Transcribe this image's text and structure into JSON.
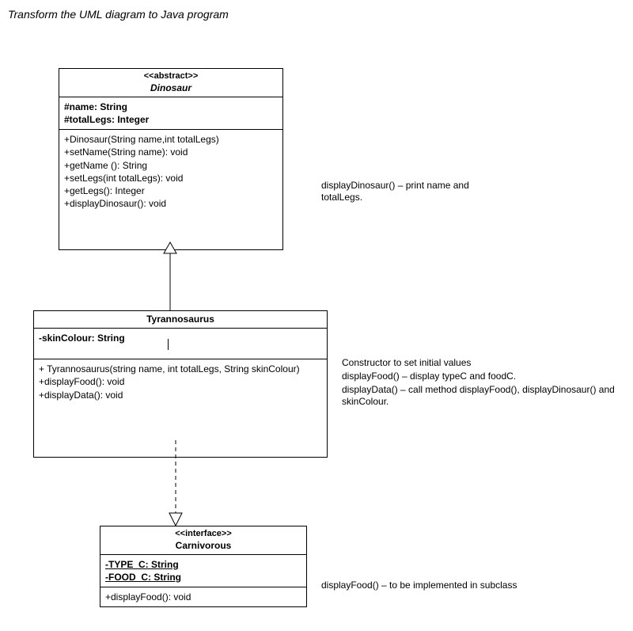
{
  "title": "Transform the UML diagram to Java program",
  "dinosaur": {
    "stereotype": "<<abstract>>",
    "name": "Dinosaur",
    "attrs": {
      "a1": "#name: String",
      "a2": "#totalLegs: Integer"
    },
    "ops": {
      "o1": "+Dinosaur(String name,int totalLegs)",
      "o2": "+setName(String name): void",
      "o3": "+getName (): String",
      "o4": "+setLegs(int totalLegs): void",
      "o5": "+getLegs(): Integer",
      "o6": "+displayDinosaur(): void"
    }
  },
  "tyranno": {
    "name": "Tyrannosaurus",
    "attrs": {
      "a1": "-skinColour: String"
    },
    "ops": {
      "o1": "+ Tyrannosaurus(string name, int totalLegs, String skinColour)",
      "o2": "+displayFood(): void",
      "o3": "+displayData(): void"
    }
  },
  "carnivorous": {
    "stereotype": "<<interface>>",
    "name": "Carnivorous",
    "attrs": {
      "a1": "-TYPE_C: String",
      "a2": "-FOOD_C: String"
    },
    "ops": {
      "o1": "+displayFood(): void"
    }
  },
  "notes": {
    "dino": "displayDinosaur() – print name and totalLegs.",
    "tyr1": "Constructor to set initial values",
    "tyr2": "displayFood() – display typeC and foodC.",
    "tyr3": "displayData() – call method displayFood(), displayDinosaur() and skinColour.",
    "carn": "displayFood() – to be implemented in subclass"
  }
}
